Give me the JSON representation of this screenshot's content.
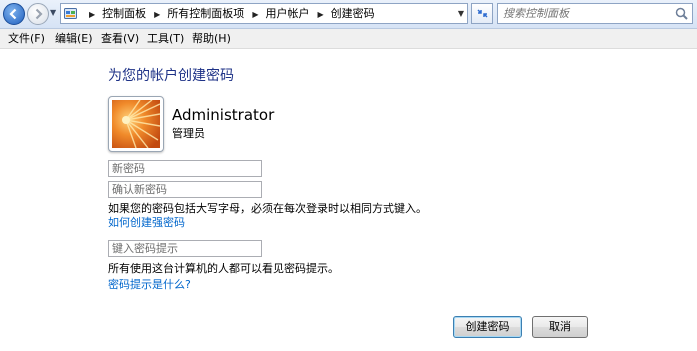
{
  "address_bar": {
    "breadcrumbs": [
      "控制面板",
      "所有控制面板项",
      "用户帐户",
      "创建密码"
    ],
    "search_placeholder": "搜索控制面板"
  },
  "menu": {
    "items": [
      "文件(F)",
      "编辑(E)",
      "查看(V)",
      "工具(T)",
      "帮助(H)"
    ]
  },
  "page": {
    "title": "为您的帐户创建密码",
    "user": {
      "name": "Administrator",
      "role": "管理员"
    },
    "new_password_placeholder": "新密码",
    "confirm_password_placeholder": "确认新密码",
    "case_note": "如果您的密码包括大写字母，必须在每次登录时以相同方式键入。",
    "strong_password_link": "如何创建强密码",
    "hint_placeholder": "键入密码提示",
    "hint_note": "所有使用这台计算机的人都可以看见密码提示。",
    "hint_link": "密码提示是什么?"
  },
  "buttons": {
    "create": "创建密码",
    "cancel": "取消"
  },
  "colors": {
    "heading": "#1e3287",
    "link": "#0066cc",
    "accent": "#1f5fbf"
  }
}
